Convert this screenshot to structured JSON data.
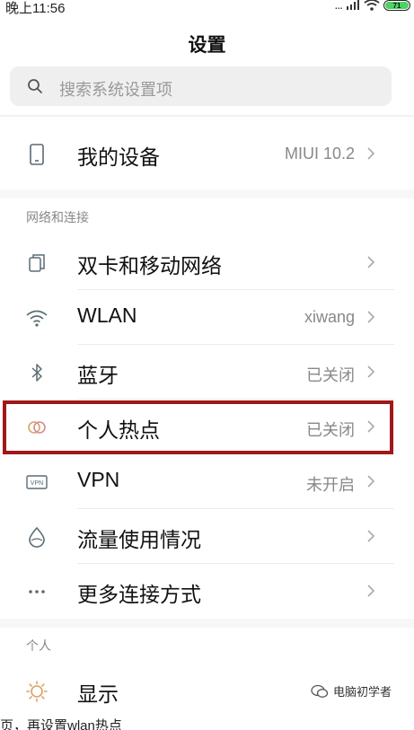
{
  "status_bar": {
    "time": "晚上11:56",
    "dots": "...",
    "battery_level": "71",
    "battery_color": "#4cd263"
  },
  "header": {
    "title": "设置"
  },
  "search": {
    "placeholder": "搜索系统设置项"
  },
  "device_row": {
    "label": "我的设备",
    "value": "MIUI 10.2",
    "icon": "phone-icon"
  },
  "sections": [
    {
      "header": "网络和连接",
      "items": [
        {
          "label": "双卡和移动网络",
          "value": "",
          "icon": "sim-card-icon"
        },
        {
          "label": "WLAN",
          "value": "xiwang",
          "icon": "wifi-icon"
        },
        {
          "label": "蓝牙",
          "value": "已关闭",
          "icon": "bluetooth-icon"
        },
        {
          "label": "个人热点",
          "value": "已关闭",
          "icon": "hotspot-icon"
        },
        {
          "label": "VPN",
          "value": "未开启",
          "icon": "vpn-icon"
        },
        {
          "label": "流量使用情况",
          "value": "",
          "icon": "water-drop-icon"
        },
        {
          "label": "更多连接方式",
          "value": "",
          "icon": "more-dots-icon"
        }
      ]
    },
    {
      "header": "个人",
      "items": [
        {
          "label": "显示",
          "value": "",
          "icon": "brightness-icon"
        }
      ]
    }
  ],
  "highlight_color": "#a01818",
  "watermark": {
    "text": "电脑初学者"
  },
  "caption": {
    "text": "页，再设置wlan热点"
  }
}
